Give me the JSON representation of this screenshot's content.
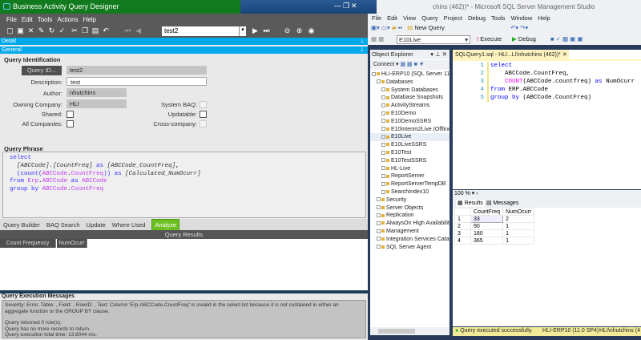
{
  "baq": {
    "title": "Business Activity Query Designer",
    "menu": [
      "File",
      "Edit",
      "Tools",
      "Actions",
      "Help"
    ],
    "nav_value": "test2",
    "detail_bar": "Detail",
    "general_bar": "General",
    "query_identification": "Query Identification",
    "query_id_button": "Query ID...",
    "query_id": "test2",
    "description_label": "Description:",
    "description": "test",
    "author_label": "Author:",
    "author": "nhutchins",
    "owning_company_label": "Owning Company:",
    "owning_company": "HLI",
    "shared_label": "Shared:",
    "all_companies_label": "All Companies:",
    "system_baq_label": "System BAQ:",
    "updatable_label": "Updatable:",
    "cross_company_label": "Cross-company:",
    "query_phrase_title": "Query Phrase",
    "tabs": [
      "Query Builder",
      "BAQ Search",
      "Update",
      "Where Used",
      "Analyze"
    ],
    "query_results_title": "Query Results",
    "result_columns": [
      "Count Frequency",
      "NumOcurr"
    ],
    "messages_title": "Query Execution Messages",
    "messages": [
      "Severity: Error, Table: , Field: , RowID: , Text: Column 'Erp.ABCCode.CountFreq' is invalid in the select list because it is not contained in either an aggregate function or the GROUP BY clause.",
      "Query returned 0 row(s).",
      "Query has no more records to return.",
      "Query execution total time: 13.8044 ms."
    ]
  },
  "ssms": {
    "title": "chins (462))* - Microsoft SQL Server Management Studio",
    "menu": [
      "File",
      "Edit",
      "View",
      "Query",
      "Project",
      "Debug",
      "Tools",
      "Window",
      "Help"
    ],
    "new_query": "New Query",
    "database": "E10Live",
    "execute": "Execute",
    "debug": "Debug",
    "object_explorer": "Object Explorer",
    "connect": "Connect",
    "tree": [
      "HLI-ERP10 (SQL Server 11.0.",
      "Databases",
      "System Databases",
      "Database Snapshots",
      "ActivityStreams",
      "E10Demo",
      "E10DemoSSRS",
      "E10Interim2Live (Offline)",
      "E10Live",
      "E10LiveSSRS",
      "E10Test",
      "E10TestSSRS",
      "HL-Live",
      "ReportServer",
      "ReportServerTempDB",
      "SearchIndex10",
      "Security",
      "Server Objects",
      "Replication",
      "AlwaysOn High Availability",
      "Management",
      "Integration Services Catalo",
      "SQL Server Agent"
    ],
    "editor_tab": "SQLQuery1.sql - HLI...LI\\nhutchins (462))*",
    "zoom": "100 %",
    "results_tab": "Results",
    "messages_tab": "Messages",
    "grid_columns": [
      "CountFreq",
      "NumOcurr"
    ],
    "grid_rows": [
      [
        "1",
        "33",
        "2"
      ],
      [
        "2",
        "90",
        "1"
      ],
      [
        "3",
        "180",
        "1"
      ],
      [
        "4",
        "365",
        "1"
      ]
    ],
    "status": "Query executed successfully.",
    "server": "HLI-ERP10 (11.0 SP4)",
    "user": "HLI\\nhutchins (4"
  }
}
